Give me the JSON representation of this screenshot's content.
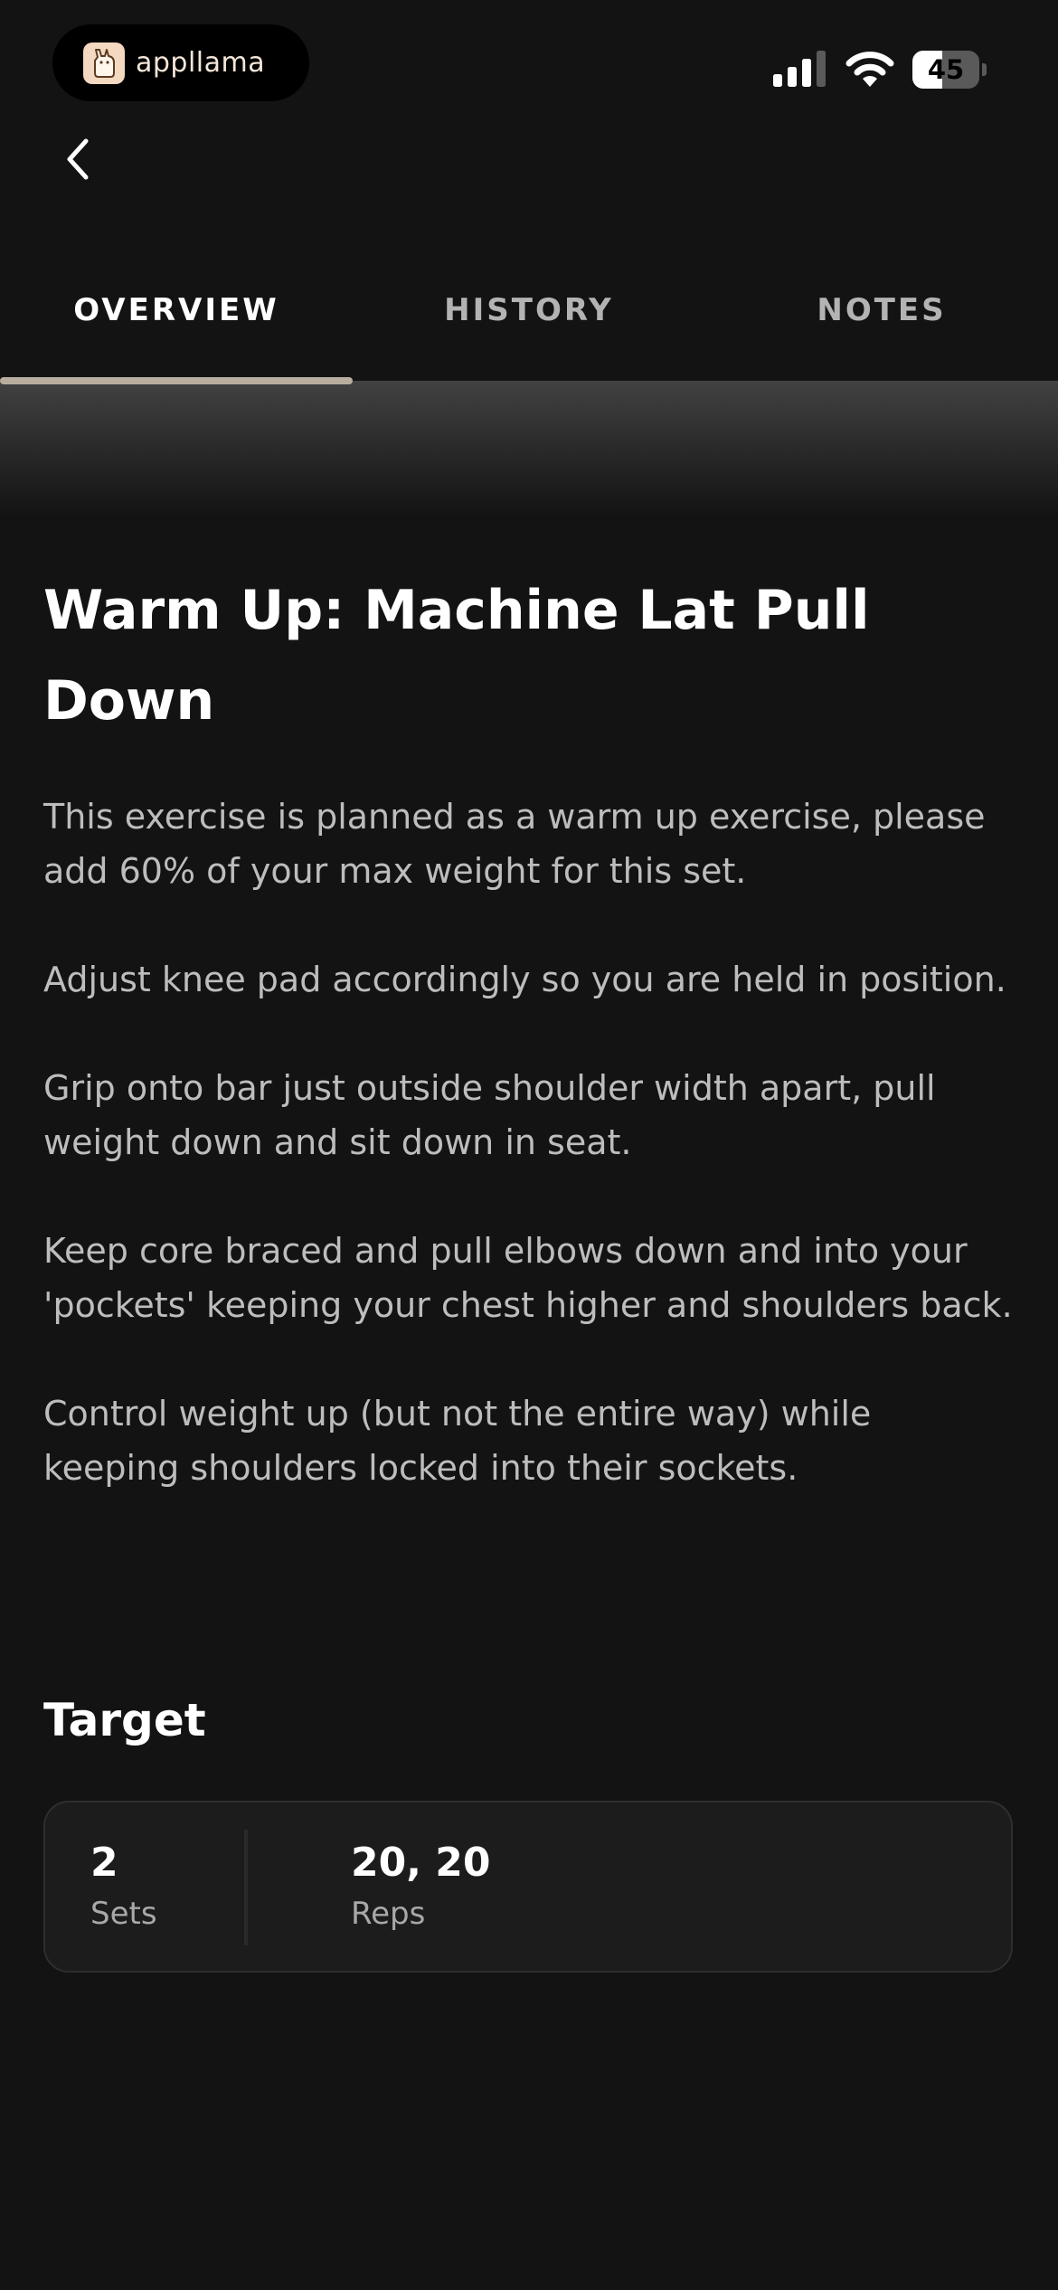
{
  "status_bar": {
    "app_name": "appllama",
    "battery_level": "45",
    "battery_percent": 45
  },
  "tabs": [
    {
      "label": "OVERVIEW",
      "active": true
    },
    {
      "label": "HISTORY",
      "active": false
    },
    {
      "label": "NOTES",
      "active": false
    }
  ],
  "exercise": {
    "title": "Warm Up: Machine Lat Pull Down",
    "paragraphs": [
      "This exercise is planned as a warm up exercise, please add 60% of your max weight for this set.",
      "Adjust knee pad accordingly so you are held in position.",
      "Grip onto bar just outside shoulder width apart, pull weight down and sit down in seat.",
      "Keep core braced and pull elbows down and into your 'pockets' keeping your chest higher and shoulders back.",
      "Control weight up (but not the entire way) while keeping shoulders locked into their sockets."
    ]
  },
  "target": {
    "heading": "Target",
    "sets_value": "2",
    "sets_label": "Sets",
    "reps_value": "20, 20",
    "reps_label": "Reps"
  },
  "colors": {
    "background": "#131313",
    "card": "#1c1c1c",
    "tab_indicator": "#b9ada0",
    "body_text": "#bdbdbd"
  },
  "icons": {
    "back": "chevron-left-icon",
    "signal": "cellular-signal-icon",
    "wifi": "wifi-icon",
    "battery": "battery-icon",
    "app_logo": "llama-logo-icon"
  }
}
